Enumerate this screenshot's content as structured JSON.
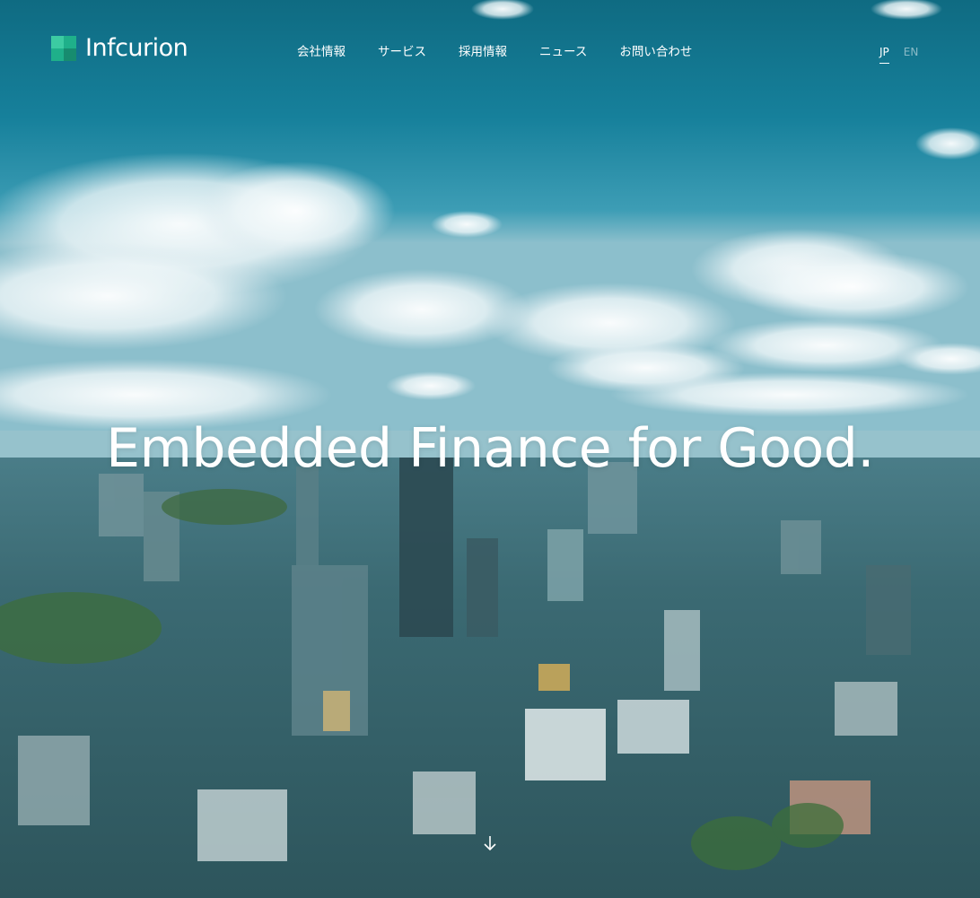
{
  "brand": {
    "name": "Infcurion",
    "accent_color": "#1fb08a"
  },
  "nav": {
    "items": [
      {
        "label": "会社情報"
      },
      {
        "label": "サービス"
      },
      {
        "label": "採用情報"
      },
      {
        "label": "ニュース"
      },
      {
        "label": "お問い合わせ"
      }
    ]
  },
  "lang": {
    "active": "JP",
    "inactive": "EN"
  },
  "hero": {
    "headline": "Embedded Finance for Good.",
    "scroll_icon": "arrow-down-icon"
  }
}
